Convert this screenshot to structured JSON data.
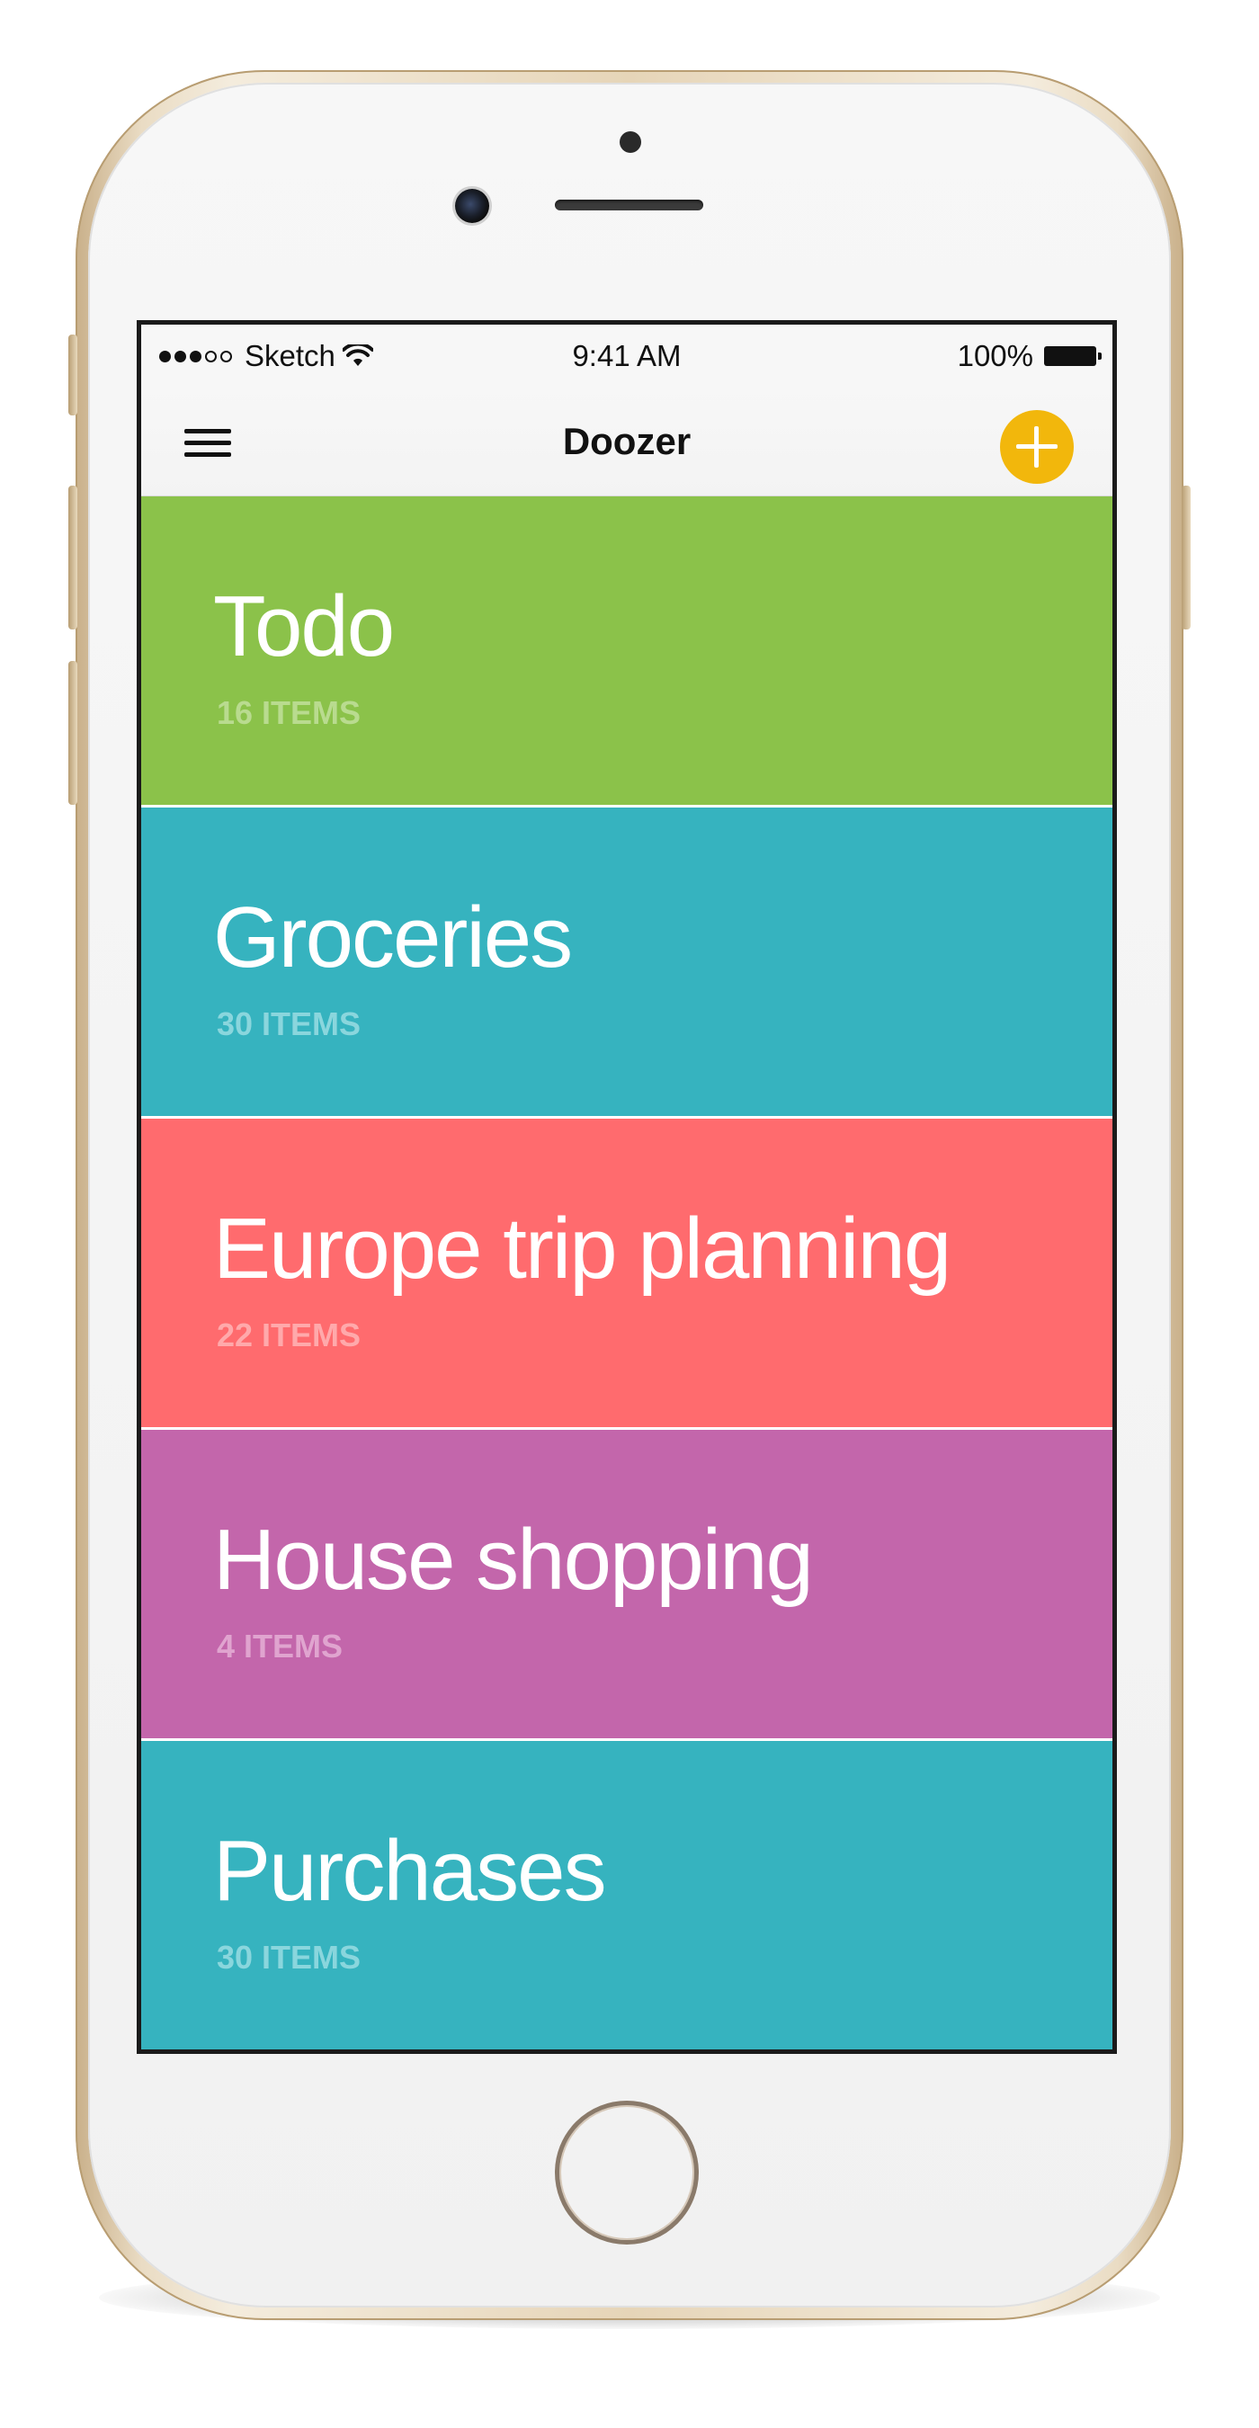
{
  "status_bar": {
    "carrier": "Sketch",
    "time": "9:41 AM",
    "battery": "100%",
    "signal_icon": "signal-dots-icon",
    "wifi_icon": "wifi-icon",
    "battery_icon": "battery-icon"
  },
  "nav": {
    "title": "Doozer",
    "menu_icon": "hamburger-menu-icon",
    "add_icon": "plus-icon",
    "add_color": "#f2b70c"
  },
  "lists": [
    {
      "title": "Todo",
      "count": "16 ITEMS",
      "color": "#8bc24a",
      "count_color": "#b9db8f"
    },
    {
      "title": "Groceries",
      "count": "30 ITEMS",
      "color": "#36b3bf",
      "count_color": "#8ad6dd"
    },
    {
      "title": "Europe trip planning",
      "count": "22 ITEMS",
      "color": "#ff6b6e",
      "count_color": "#ffa9ab"
    },
    {
      "title": "House shopping",
      "count": "4 ITEMS",
      "color": "#c366ab",
      "count_color": "#e0a4cf"
    },
    {
      "title": "Purchases",
      "count": "30 ITEMS",
      "color": "#36b3bf",
      "count_color": "#8ad6dd"
    }
  ]
}
